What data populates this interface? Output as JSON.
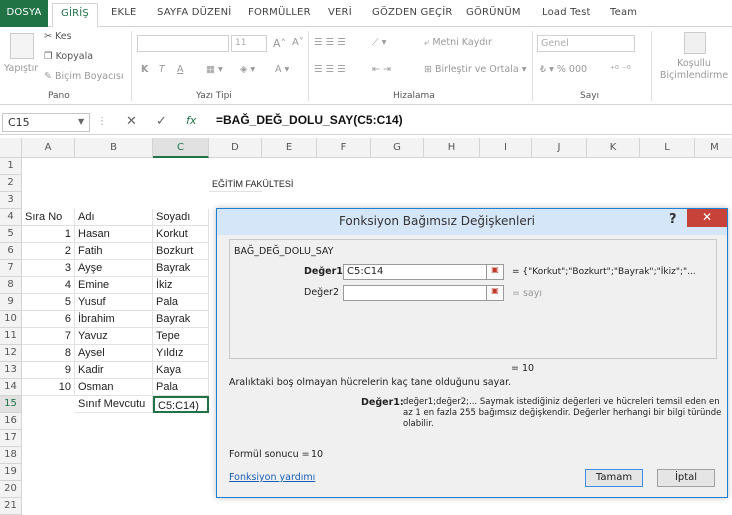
{
  "menu": {
    "tabs": [
      "DOSYA",
      "GİRİŞ",
      "EKLE",
      "SAYFA DÜZENİ",
      "FORMÜLLER",
      "VERİ",
      "GÖZDEN GEÇİR",
      "GÖRÜNÜM",
      "Load Test",
      "Team"
    ]
  },
  "ribbon": {
    "paste": "Yapıştır",
    "cut": "Kes",
    "copy": "Kopyala",
    "format_painter": "Biçim Boyacısı",
    "clipboard_group": "Pano",
    "font_group": "Yazı Tipi",
    "font_size": "11",
    "bold": "K",
    "italic": "T",
    "underline": "A",
    "wrap_text": "Metni Kaydır",
    "merge_center": "Birleştir ve Ortala",
    "alignment_group": "Hizalama",
    "number_format": "Genel",
    "number_group": "Sayı",
    "conditional_formatting": "Koşullu Biçimlendirme"
  },
  "formula_bar": {
    "name_box": "C15",
    "fx": "fx",
    "formula": "=BAĞ_DEĞ_DOLU_SAY(C5:C14)"
  },
  "grid": {
    "columns": [
      "A",
      "B",
      "C",
      "D",
      "E",
      "F",
      "G",
      "H",
      "I",
      "J",
      "K",
      "L",
      "M"
    ],
    "rows": [
      "1",
      "2",
      "3",
      "4",
      "5",
      "6",
      "7",
      "8",
      "9",
      "10",
      "11",
      "12",
      "13",
      "14",
      "15",
      "16",
      "17",
      "18",
      "19",
      "20",
      "21"
    ],
    "title": "EĞİTİM FAKÜLTESİ",
    "headers": [
      "Sıra No",
      "Adı",
      "Soyadı"
    ],
    "records": [
      {
        "no": "1",
        "ad": "Hasan",
        "soyad": "Korkut"
      },
      {
        "no": "2",
        "ad": "Fatih",
        "soyad": "Bozkurt"
      },
      {
        "no": "3",
        "ad": "Ayşe",
        "soyad": "Bayrak"
      },
      {
        "no": "4",
        "ad": "Emine",
        "soyad": "İkiz"
      },
      {
        "no": "5",
        "ad": "Yusuf",
        "soyad": "Pala"
      },
      {
        "no": "6",
        "ad": "İbrahim",
        "soyad": "Bayrak"
      },
      {
        "no": "7",
        "ad": "Yavuz",
        "soyad": "Tepe"
      },
      {
        "no": "8",
        "ad": "Aysel",
        "soyad": "Yıldız"
      },
      {
        "no": "9",
        "ad": "Kadir",
        "soyad": "Kaya"
      },
      {
        "no": "10",
        "ad": "Osman",
        "soyad": "Pala"
      }
    ],
    "row15_label": "Sınıf Mevcutu",
    "row15_value": "C5:C14)"
  },
  "dialog": {
    "title": "Fonksiyon Bağımsız Değişkenleri",
    "help": "?",
    "close": "✕",
    "function_name": "BAĞ_DEĞ_DOLU_SAY",
    "arg1_label": "Değer1",
    "arg1_value": "C5:C14",
    "arg1_result": "= {\"Korkut\";\"Bozkurt\";\"Bayrak\";\"İkiz\";\"...",
    "arg2_label": "Değer2",
    "arg2_value": "",
    "arg2_result": "= sayı",
    "total_result": "= 10",
    "description": "Aralıktaki boş olmayan hücrelerin kaç tane olduğunu sayar.",
    "param_name": "Değer1:",
    "param_desc": "değer1;değer2;... Saymak istediğiniz değerleri ve hücreleri temsil eden en az 1 en fazla 255 bağımsız değişkendir. Değerler herhangi bir bilgi türünde olabilir.",
    "formula_result_label": "Formül sonucu =",
    "formula_result_value": "10",
    "help_link": "Fonksiyon yardımı",
    "ok": "Tamam",
    "cancel": "İptal"
  },
  "colors": {
    "accent": "#217346",
    "dialog_border": "#1e7fd3",
    "close_red": "#c7433a"
  }
}
